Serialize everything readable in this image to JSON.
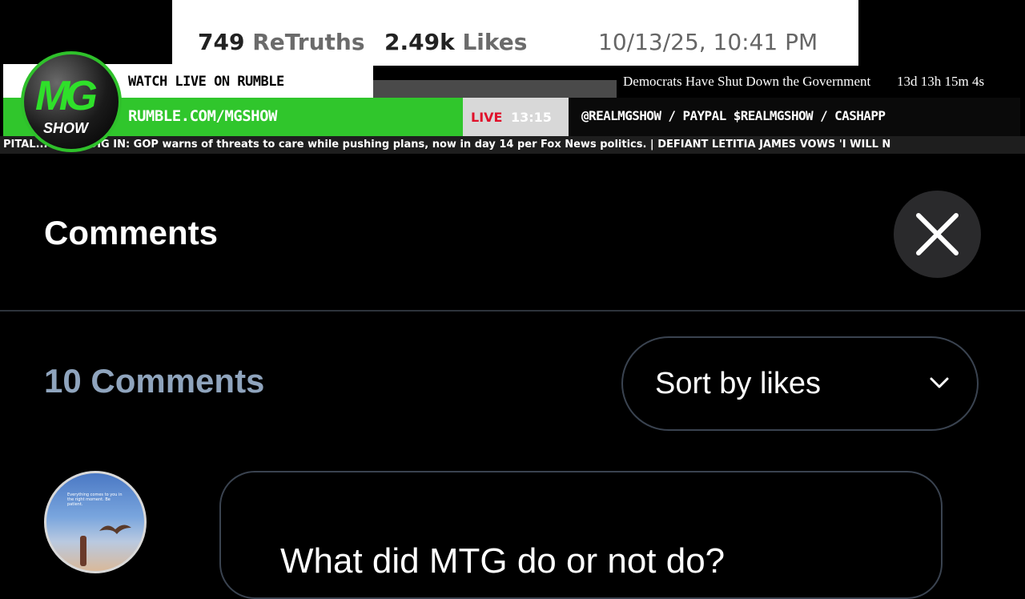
{
  "broadcast": {
    "retruths_count": "749",
    "retruths_label": "ReTruths",
    "likes_count": "2.49k",
    "likes_label": "Likes",
    "post_datetime": "10/13/25, 10:41 PM",
    "watch_live": "WATCH LIVE ON RUMBLE",
    "rumble_url": "RUMBLE.COM/MGSHOW",
    "gov_headline": "Democrats Have Shut Down the Government",
    "gov_timer": "13d 13h 15m 4s",
    "live_label": "LIVE",
    "live_time": "13:15",
    "social_handles": "@REALMGSHOW / PAYPAL $REALMGSHOW / CASHAPP",
    "ticker_text": "PITAL... DEMS DIG IN: GOP warns of threats to care while pushing plans, now in day 14 per Fox News politics.   |   DEFIANT LETITIA JAMES VOWS 'I WILL N",
    "logo_letters": "MG",
    "logo_word": "SHOW"
  },
  "comments_panel": {
    "title": "Comments",
    "count_label": "10 Comments",
    "sort": {
      "selected": "Sort by likes"
    },
    "comments": [
      {
        "avatar_caption": "Everything comes to you in the right moment. Be patient.",
        "text": "What did MTG do or not do?"
      }
    ]
  },
  "icons": {
    "close": "close-icon",
    "sort_chevron": "chevron-down-icon"
  }
}
